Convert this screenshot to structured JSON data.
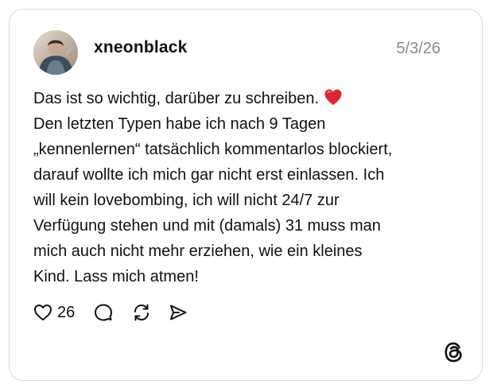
{
  "post": {
    "username": "xneonblack",
    "date": "5/3/26",
    "text_lines": [
      "Das ist so wichtig, darüber zu schreiben.",
      "Den letzten Typen habe ich nach 9 Tagen",
      "„kennenlernen“ tatsächlich kommentarlos blockiert,",
      "darauf wollte ich mich gar nicht erst einlassen. Ich",
      "will kein lovebombing, ich will nicht 24/7 zur",
      "Verfügung stehen und mit (damals) 31 muss man",
      "mich auch nicht mehr erziehen, wie ein kleines",
      "Kind. Lass mich atmen!"
    ],
    "emoji": "red-heart-emoji",
    "like_count": "26"
  },
  "icons": {
    "like": "heart-outline-icon",
    "reply": "speech-bubble-icon",
    "repost": "repost-icon",
    "share": "send-icon",
    "brand": "threads-logo"
  },
  "colors": {
    "text": "#111111",
    "muted": "#8a8a8a",
    "border": "#d9d9d9",
    "heart": "#e0242f"
  }
}
